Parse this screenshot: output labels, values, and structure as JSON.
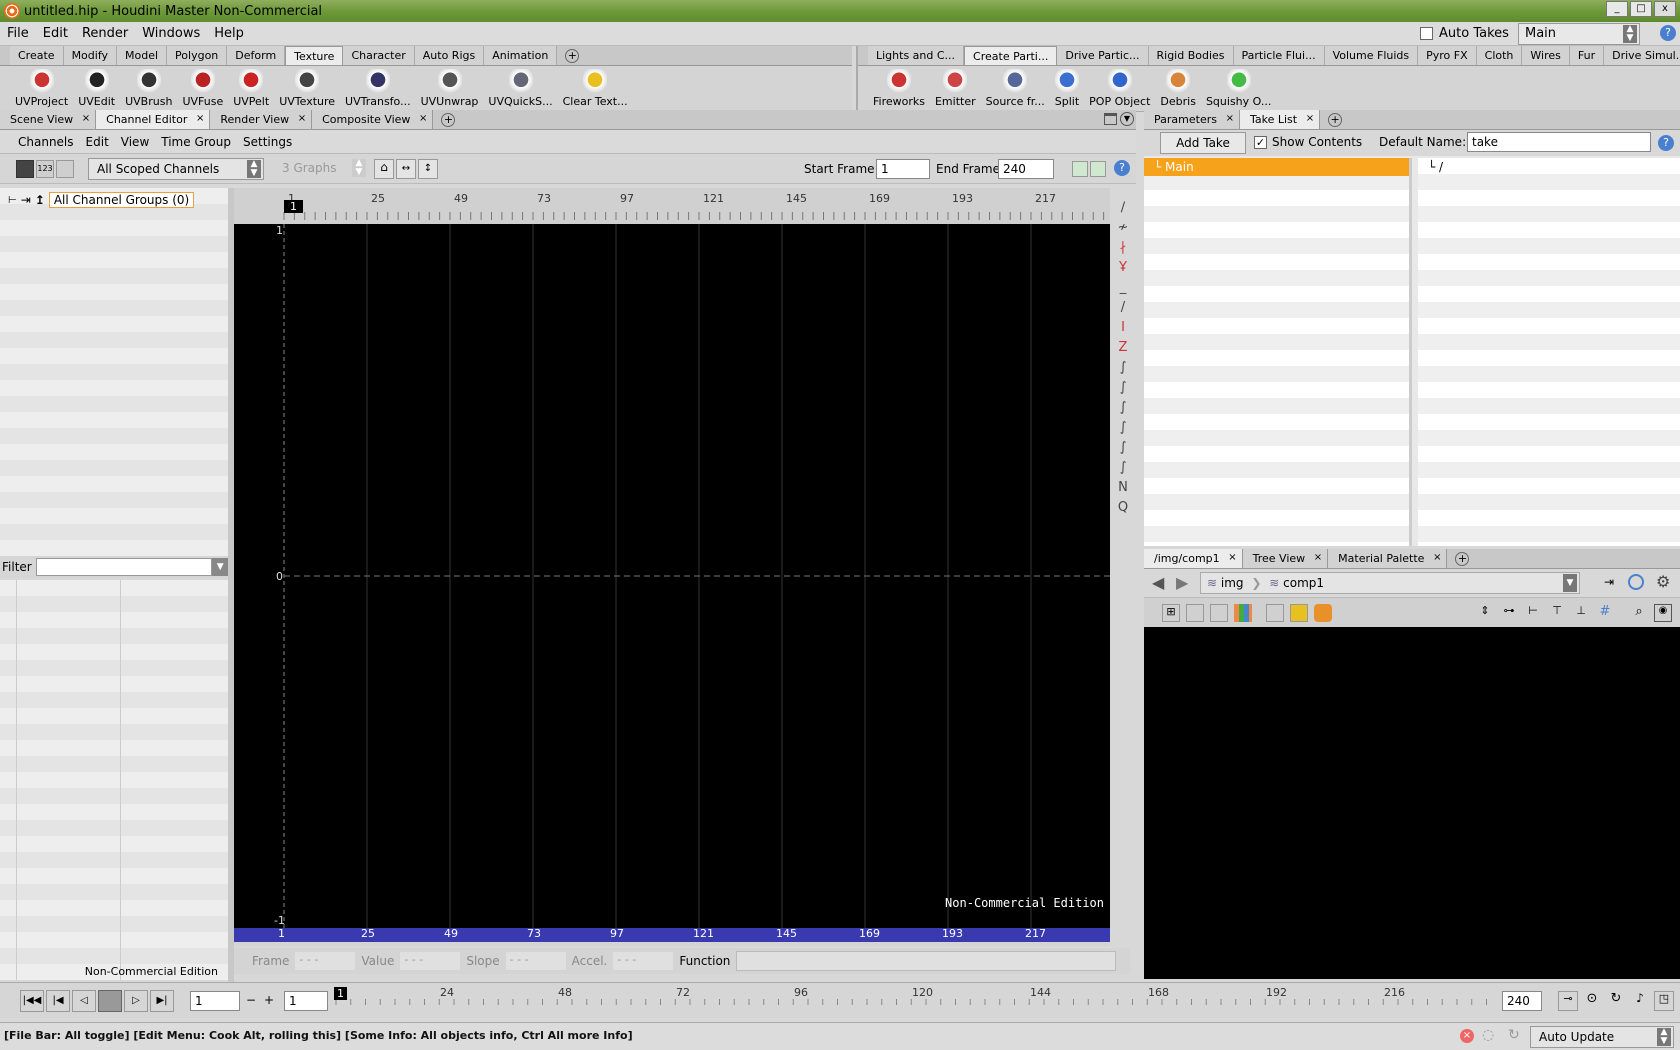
{
  "window": {
    "title": "untitled.hip - Houdini Master Non-Commercial",
    "buttons": [
      "_",
      "□",
      "x"
    ]
  },
  "menu": {
    "items": [
      "File",
      "Edit",
      "Render",
      "Windows",
      "Help"
    ],
    "auto_takes_label": "Auto Takes",
    "take_select": "Main"
  },
  "left_shelf": {
    "tabs": [
      "Create",
      "Modify",
      "Model",
      "Polygon",
      "Deform",
      "Texture",
      "Character",
      "Auto Rigs",
      "Animation"
    ],
    "active_tab": "Texture",
    "tools": [
      {
        "label": "UVProject",
        "icon": "uvproject-icon",
        "color": "#c33"
      },
      {
        "label": "UVEdit",
        "icon": "uvedit-icon",
        "color": "#222"
      },
      {
        "label": "UVBrush",
        "icon": "uvbrush-icon",
        "color": "#333"
      },
      {
        "label": "UVFuse",
        "icon": "uvfuse-icon",
        "color": "#b22"
      },
      {
        "label": "UVPelt",
        "icon": "uvpelt-icon",
        "color": "#c22"
      },
      {
        "label": "UVTexture",
        "icon": "uvtexture-icon",
        "color": "#444"
      },
      {
        "label": "UVTransfo...",
        "icon": "uvtransform-icon",
        "color": "#336"
      },
      {
        "label": "UVUnwrap",
        "icon": "uvunwrap-icon",
        "color": "#555"
      },
      {
        "label": "UVQuickS...",
        "icon": "uvquickshade-icon",
        "color": "#667"
      },
      {
        "label": "Clear Text...",
        "icon": "clear-texture-icon",
        "color": "#e8c020"
      }
    ]
  },
  "right_shelf": {
    "tabs": [
      "Lights and C...",
      "Create Parti...",
      "Drive Partic...",
      "Rigid Bodies",
      "Particle Flui...",
      "Volume Fluids",
      "Pyro FX",
      "Cloth",
      "Wires",
      "Fur",
      "Drive Simul..."
    ],
    "active_tab": "Create Parti...",
    "tools": [
      {
        "label": "Fireworks",
        "icon": "fireworks-icon",
        "color": "#c33"
      },
      {
        "label": "Emitter",
        "icon": "emitter-icon",
        "color": "#c44"
      },
      {
        "label": "Source fr...",
        "icon": "source-from-icon",
        "color": "#569"
      },
      {
        "label": "Split",
        "icon": "split-icon",
        "color": "#3a6fd0"
      },
      {
        "label": "POP Object",
        "icon": "pop-object-icon",
        "color": "#36c"
      },
      {
        "label": "Debris",
        "icon": "debris-icon",
        "color": "#d8843a"
      },
      {
        "label": "Squishy O...",
        "icon": "squishy-icon",
        "color": "#4b4"
      }
    ]
  },
  "main_tabs": {
    "items": [
      "Scene View",
      "Channel Editor",
      "Render View",
      "Composite View"
    ],
    "active": "Channel Editor"
  },
  "channel_editor": {
    "menu": [
      "Channels",
      "Edit",
      "View",
      "Time Group",
      "Settings"
    ],
    "scope_select": "All Scoped Channels",
    "graphs": "3 Graphs",
    "start_frame_label": "Start Frame",
    "start_frame": "1",
    "end_frame_label": "End Frame",
    "end_frame": "240",
    "tree_root": "All Channel Groups (0)",
    "filter_label": "Filter",
    "watermark": "Non-Commercial Edition",
    "ruler_ticks": [
      "1",
      "25",
      "49",
      "73",
      "97",
      "121",
      "145",
      "169",
      "193",
      "217"
    ],
    "y_labels": [
      "1",
      "0",
      "-1"
    ],
    "graph_current": "1",
    "bottom_fields": [
      {
        "label": "Frame",
        "value": "- - -"
      },
      {
        "label": "Value",
        "value": "- - -"
      },
      {
        "label": "Slope",
        "value": "- - -"
      },
      {
        "label": "Accel.",
        "value": "- - -"
      }
    ],
    "function_label": "Function"
  },
  "param_tabs": {
    "items": [
      "Parameters",
      "Take List"
    ],
    "active": "Take List"
  },
  "take_list": {
    "add_take": "Add Take",
    "show_contents": "Show Contents",
    "default_name_label": "Default Name:",
    "default_name": "take",
    "takes": [
      "Main"
    ],
    "contents_root": "/"
  },
  "network_tabs": {
    "items": [
      "/img/comp1",
      "Tree View",
      "Material Palette"
    ],
    "active": "/img/comp1"
  },
  "network": {
    "path": [
      "img",
      "comp1"
    ]
  },
  "playbar": {
    "frame": "1",
    "step": "1",
    "end": "240",
    "ticks": [
      "24",
      "48",
      "72",
      "96",
      "120",
      "144",
      "168",
      "192",
      "216"
    ],
    "current": "1"
  },
  "status": {
    "text": "[File Bar: All toggle] [Edit Menu: Cook Alt, rolling this] [Some Info: All objects info, Ctrl All more Info]",
    "auto_update": "Auto Update"
  }
}
